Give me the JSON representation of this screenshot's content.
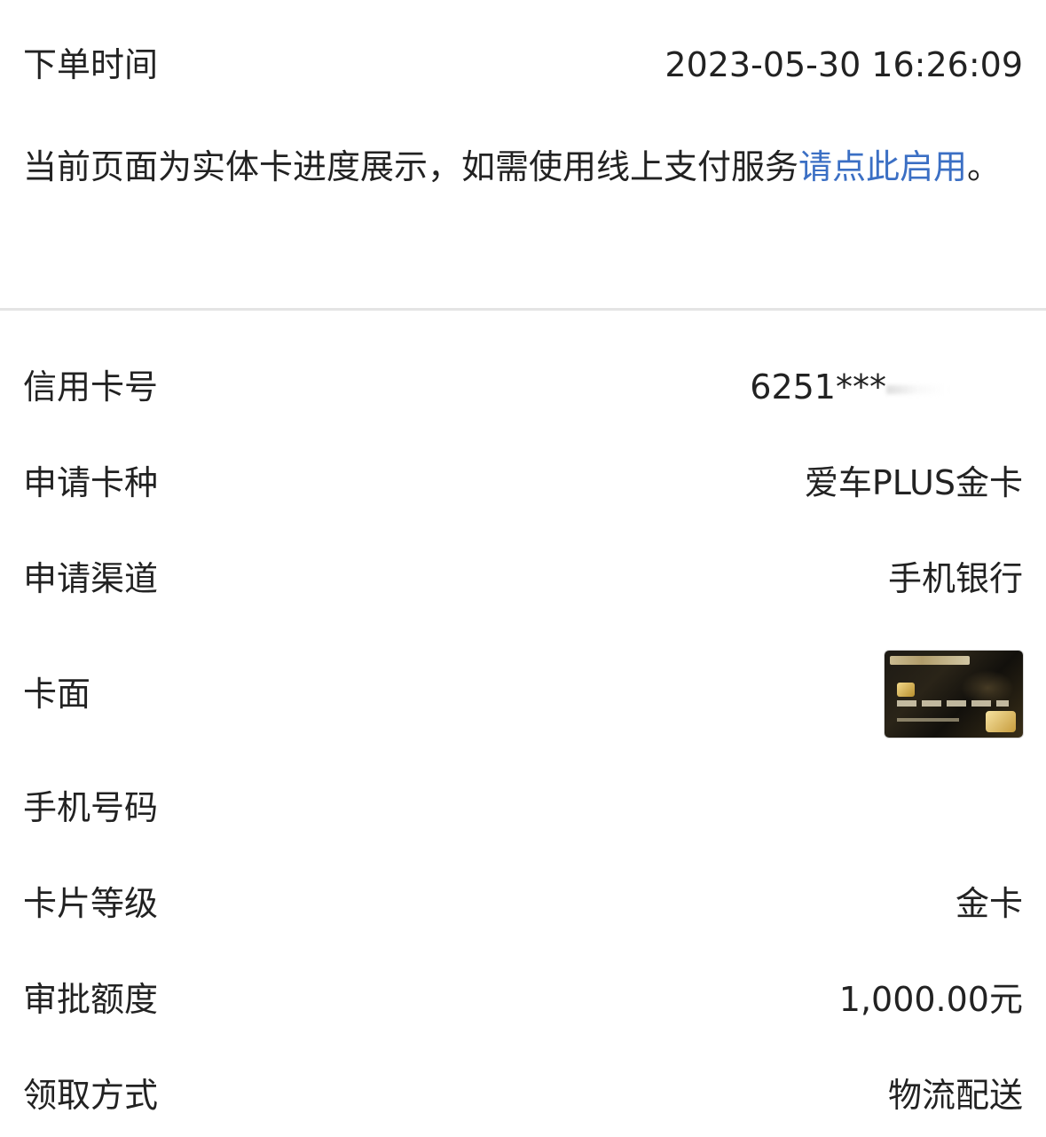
{
  "order_time": {
    "label": "下单时间",
    "value": "2023-05-30 16:26:09"
  },
  "notice": {
    "text": "当前页面为实体卡进度展示，如需使用线上支付服务",
    "link_text": "请点此启用",
    "suffix": "。"
  },
  "details": {
    "card_number": {
      "label": "信用卡号",
      "value": "6251***"
    },
    "card_type": {
      "label": "申请卡种",
      "value": "爱车PLUS金卡"
    },
    "channel": {
      "label": "申请渠道",
      "value": "手机银行"
    },
    "card_face": {
      "label": "卡面",
      "image_icon": "credit-card-image"
    },
    "phone": {
      "label": "手机号码",
      "value": ""
    },
    "card_level": {
      "label": "卡片等级",
      "value": "金卡"
    },
    "approved_limit": {
      "label": "审批额度",
      "value": "1,000.00元"
    },
    "pickup_method": {
      "label": "领取方式",
      "value": "物流配送"
    }
  },
  "colors": {
    "text": "#222222",
    "link": "#3b6fc4",
    "divider": "#e4e4e4"
  }
}
